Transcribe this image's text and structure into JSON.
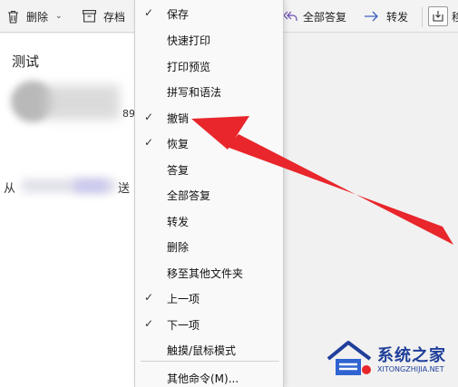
{
  "toolbar": {
    "delete_label": "删除",
    "archive_label": "存档",
    "reply_all_label": "全部答复",
    "forward_label": "转发",
    "move_label": "移"
  },
  "message": {
    "subject": "测试",
    "partial_number": "89",
    "from_label": "从",
    "sent_label": "送"
  },
  "menu": {
    "items": [
      {
        "label": "保存",
        "checked": true
      },
      {
        "label": "快速打印",
        "checked": false
      },
      {
        "label": "打印预览",
        "checked": false
      },
      {
        "label": "拼写和语法",
        "checked": false
      },
      {
        "label": "撤销",
        "checked": true
      },
      {
        "label": "恢复",
        "checked": true
      },
      {
        "label": "答复",
        "checked": false
      },
      {
        "label": "全部答复",
        "checked": false
      },
      {
        "label": "转发",
        "checked": false
      },
      {
        "label": "删除",
        "checked": false
      },
      {
        "label": "移至其他文件夹",
        "checked": false
      },
      {
        "label": "上一项",
        "checked": true
      },
      {
        "label": "下一项",
        "checked": true
      },
      {
        "label": "触摸/鼠标模式",
        "checked": false
      },
      {
        "label": "其他命令(M)...",
        "checked": false
      }
    ],
    "check_glyph": "✓"
  },
  "watermark": {
    "title": "系统之家",
    "url": "XITONGZHIJIA.NET"
  },
  "colors": {
    "arrow": "#e8262b",
    "watermark": "#1f3f9a"
  },
  "icons": [
    "trash-icon",
    "archive-icon",
    "reply-all-icon",
    "forward-icon",
    "move-icon",
    "check-icon"
  ]
}
